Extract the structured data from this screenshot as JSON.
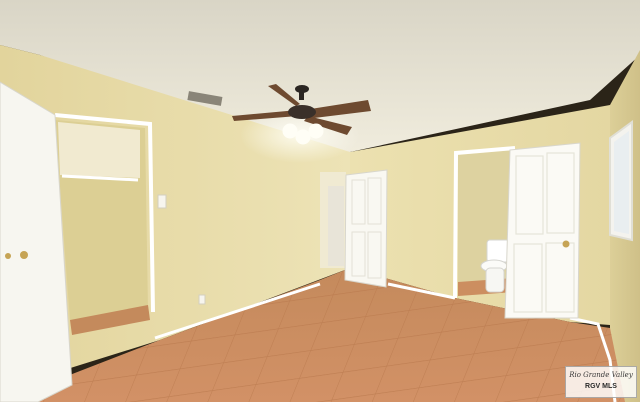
{
  "scene": {
    "description_kind": "empty bedroom interior photo",
    "palette": {
      "wall": "#e8dca8",
      "ceiling": "#ece8da",
      "floor_tile": "#c98a5a",
      "trim": "#ffffff"
    }
  },
  "watermark": {
    "script_text": "Rio Grande Valley",
    "code_text": "RGV MLS"
  }
}
